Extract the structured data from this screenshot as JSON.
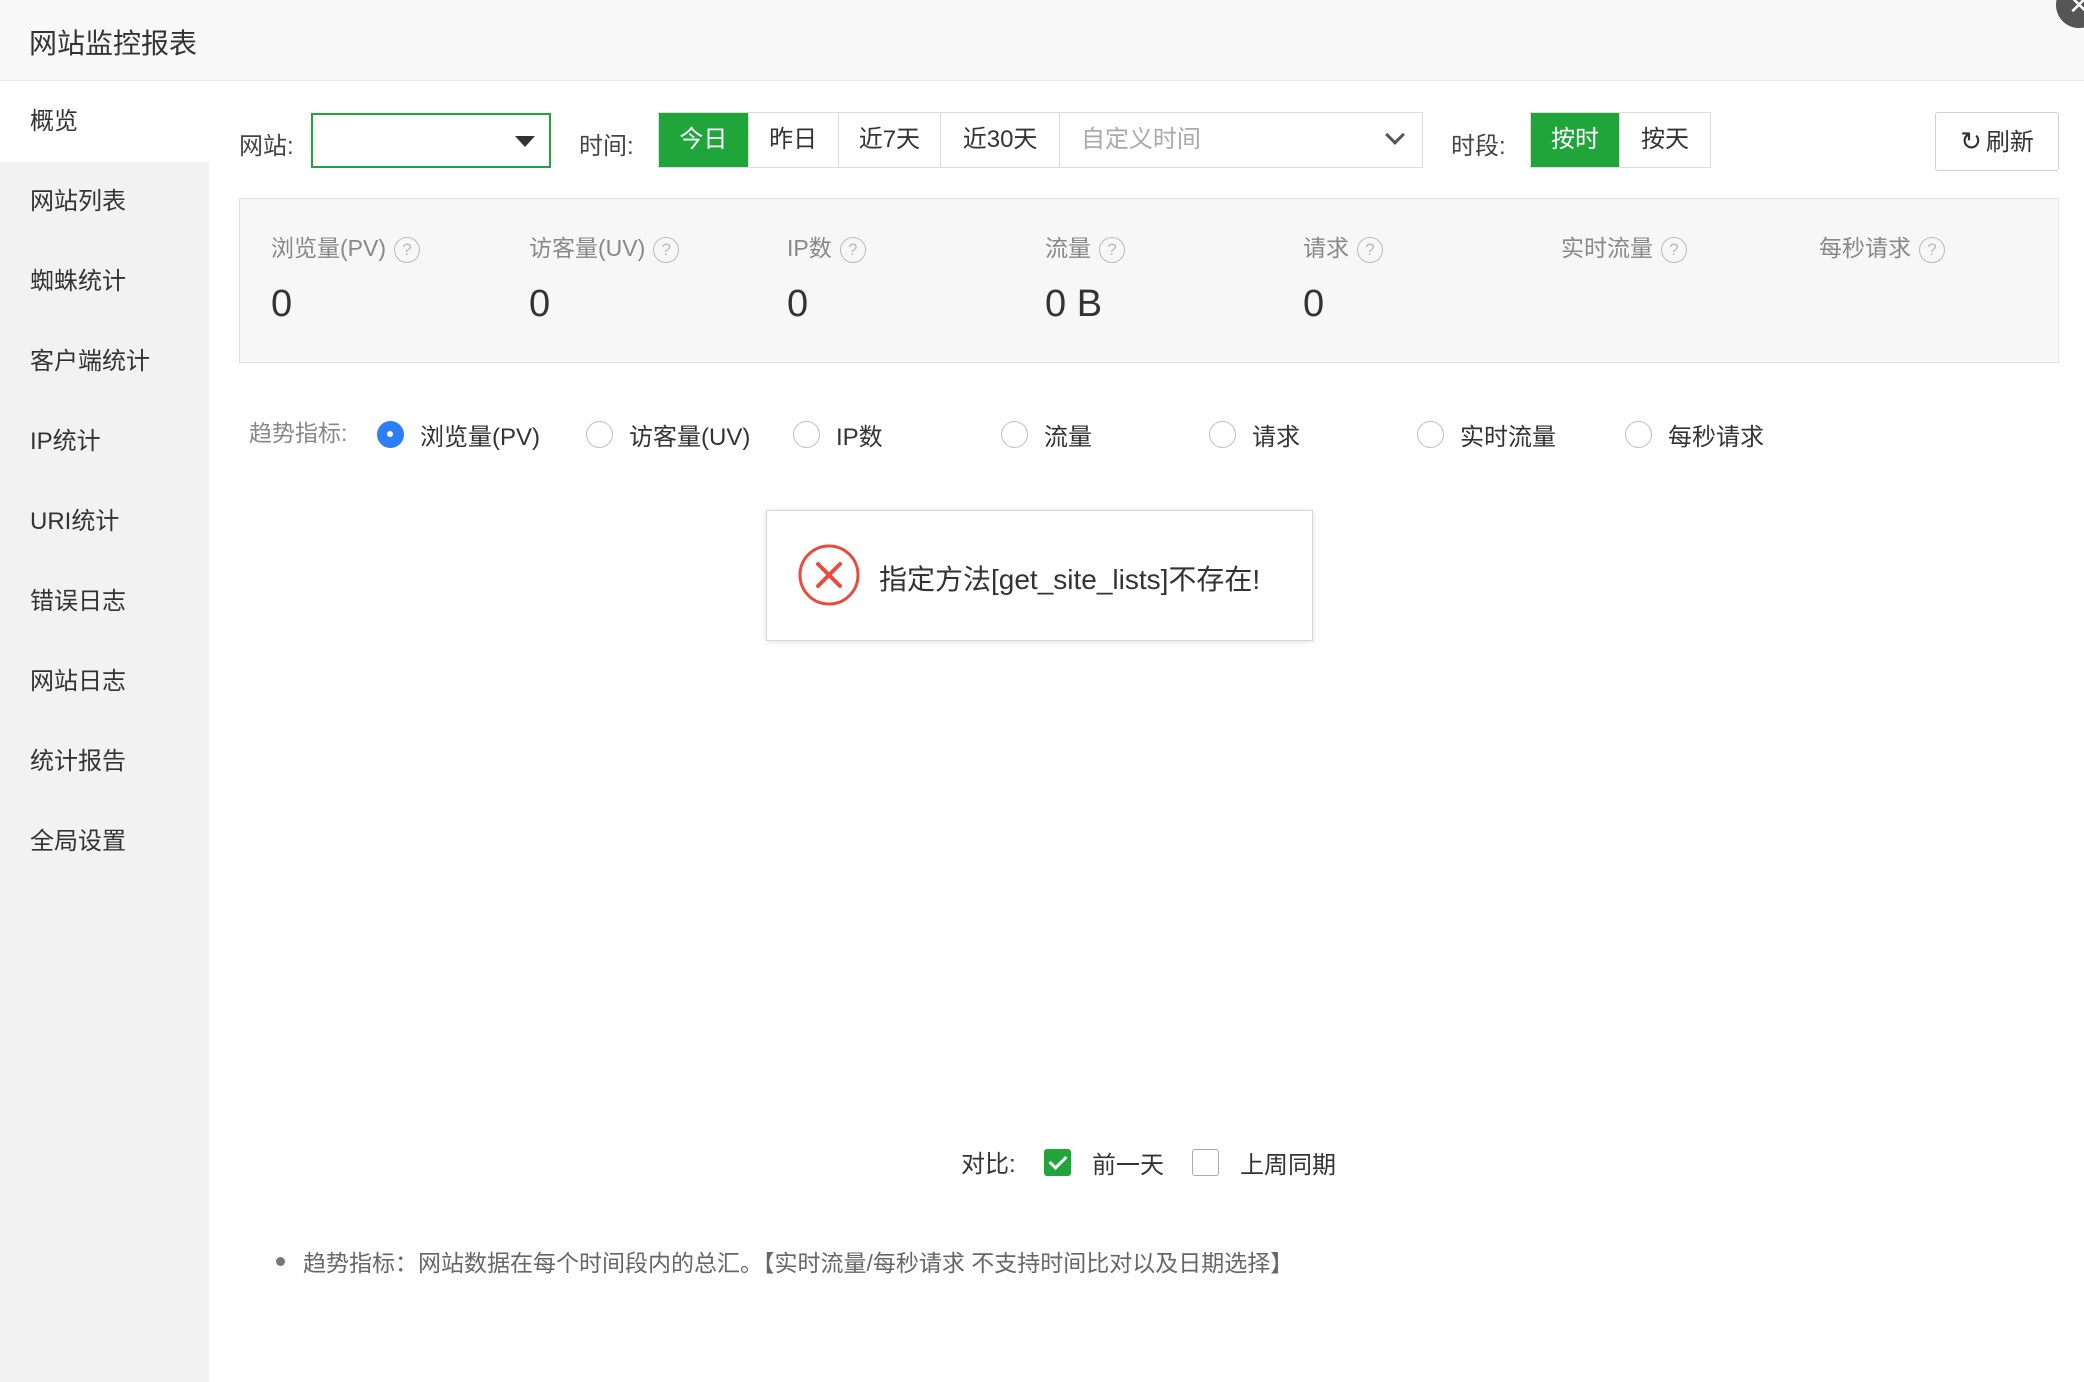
{
  "window": {
    "title": "网站监控报表",
    "close_icon": "close-icon"
  },
  "sidebar": {
    "items": [
      {
        "label": "概览",
        "active": true
      },
      {
        "label": "网站列表"
      },
      {
        "label": "蜘蛛统计"
      },
      {
        "label": "客户端统计"
      },
      {
        "label": "IP统计"
      },
      {
        "label": "URI统计"
      },
      {
        "label": "错误日志"
      },
      {
        "label": "网站日志"
      },
      {
        "label": "统计报告"
      },
      {
        "label": "全局设置"
      }
    ]
  },
  "filters": {
    "site_label": "网站:",
    "site_value": "",
    "time_label": "时间:",
    "time_options": [
      "今日",
      "昨日",
      "近7天",
      "近30天"
    ],
    "time_selected": "今日",
    "custom_time_placeholder": "自定义时间",
    "period_label": "时段:",
    "period_options": [
      "按时",
      "按天"
    ],
    "period_selected": "按时",
    "refresh_label": "刷新"
  },
  "stats": [
    {
      "label": "浏览量(PV)",
      "value": "0"
    },
    {
      "label": "访客量(UV)",
      "value": "0"
    },
    {
      "label": "IP数",
      "value": "0"
    },
    {
      "label": "流量",
      "value": "0 B"
    },
    {
      "label": "请求",
      "value": "0"
    },
    {
      "label": "实时流量",
      "value": ""
    },
    {
      "label": "每秒请求",
      "value": ""
    }
  ],
  "trend": {
    "label": "趋势指标:",
    "options": [
      "浏览量(PV)",
      "访客量(UV)",
      "IP数",
      "流量",
      "请求",
      "实时流量",
      "每秒请求"
    ],
    "selected": "浏览量(PV)"
  },
  "error_message": "指定方法[get_site_lists]不存在!",
  "compare": {
    "label": "对比:",
    "options": [
      {
        "label": "前一天",
        "checked": true
      },
      {
        "label": "上周同期",
        "checked": false
      }
    ]
  },
  "note": "趋势指标：网站数据在每个时间段内的总汇。【实时流量/每秒请求 不支持时间比对以及日期选择】",
  "colors": {
    "accent": "#20a53a",
    "radio": "#2d7ff9",
    "error": "#e84c3d"
  }
}
